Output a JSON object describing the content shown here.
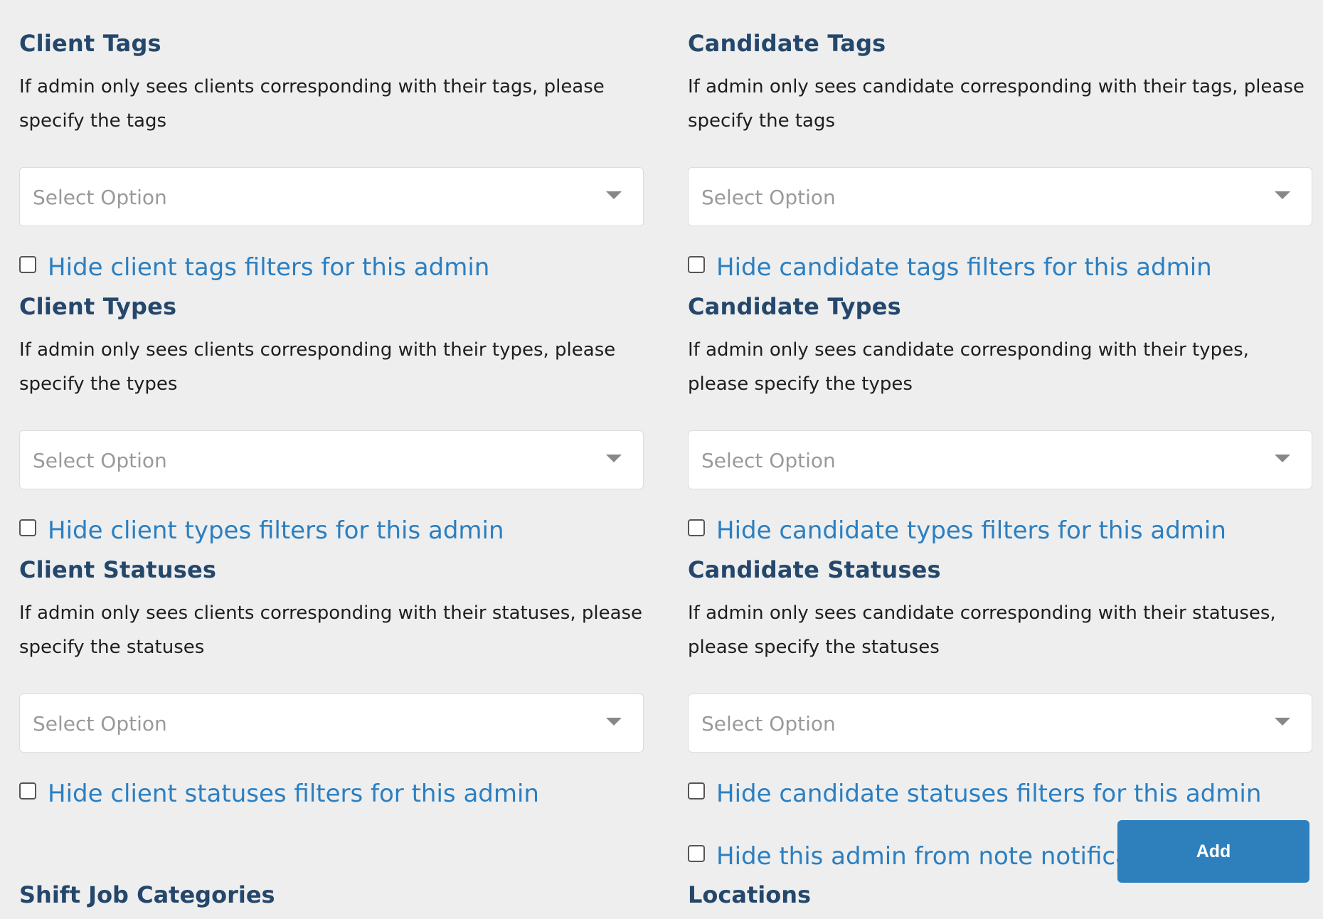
{
  "client": {
    "tags": {
      "title": "Client Tags",
      "description": "If admin only sees clients corresponding with their tags, please specify the tags",
      "placeholder": "Select Option",
      "checkbox_label": "Hide client tags filters for this admin"
    },
    "types": {
      "title": "Client Types",
      "description": "If admin only sees clients corresponding with their types, please specify the types",
      "placeholder": "Select Option",
      "checkbox_label": "Hide client types filters for this admin"
    },
    "statuses": {
      "title": "Client Statuses",
      "description": "If admin only sees clients corresponding with their statuses, please specify the statuses",
      "placeholder": "Select Option",
      "checkbox_label": "Hide client statuses filters for this admin"
    }
  },
  "candidate": {
    "tags": {
      "title": "Candidate Tags",
      "description": "If admin only sees candidate corresponding with their tags, please specify the tags",
      "placeholder": "Select Option",
      "checkbox_label": "Hide candidate tags filters for this admin"
    },
    "types": {
      "title": "Candidate Types",
      "description": "If admin only sees candidate corresponding with their types, please specify the types",
      "placeholder": "Select Option",
      "checkbox_label": "Hide candidate types filters for this admin"
    },
    "statuses": {
      "title": "Candidate Statuses",
      "description": "If admin only sees candidate corresponding with their statuses, please specify the statuses",
      "placeholder": "Select Option",
      "checkbox_label": "Hide candidate statuses filters for this admin"
    }
  },
  "note_notification": {
    "checkbox_label": "Hide this admin from note notification list"
  },
  "add_button_label": "Add",
  "shift_job_categories_title": "Shift Job Categories",
  "locations_title": "Locations",
  "colors": {
    "heading": "#24476b",
    "link_label": "#2b7fc1",
    "button": "#2e80bd",
    "background": "#eeeeee"
  }
}
